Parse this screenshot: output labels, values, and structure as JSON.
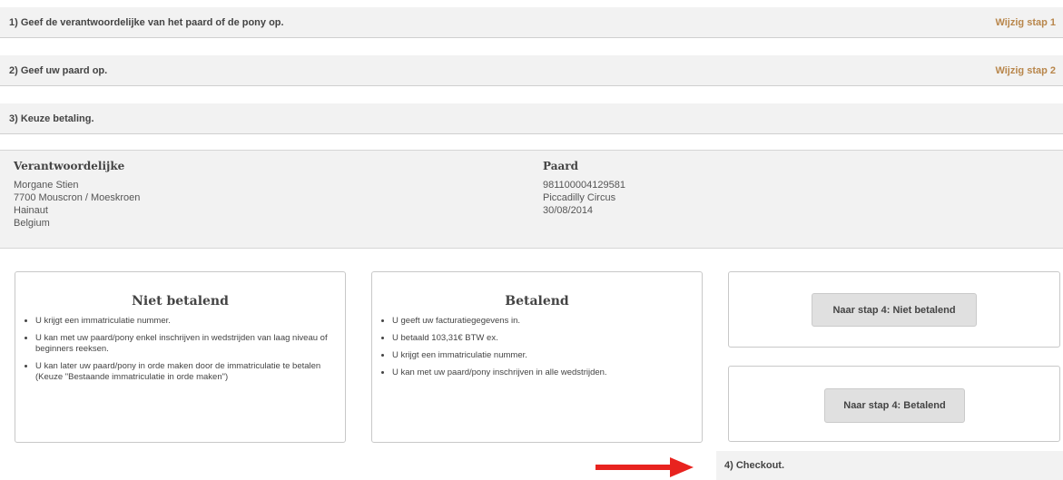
{
  "steps": {
    "step1": {
      "title": "1)  Geef de verantwoordelijke van het paard of de pony op.",
      "link": "Wijzig stap 1"
    },
    "step2": {
      "title": "2)  Geef uw paard op.",
      "link": "Wijzig stap 2"
    },
    "step3": {
      "title": "3)  Keuze betaling."
    },
    "step4": {
      "title": "4)  Checkout."
    }
  },
  "summary": {
    "responsible": {
      "heading": "Verantwoordelijke",
      "lines": [
        "Morgane Stien",
        "7700 Mouscron / Moeskroen",
        "Hainaut",
        "Belgium"
      ]
    },
    "horse": {
      "heading": "Paard",
      "lines": [
        "981100004129581",
        "Piccadilly Circus",
        "30/08/2014"
      ]
    }
  },
  "options": {
    "niet_betalend": {
      "title": "Niet betalend",
      "items": [
        "U krijgt een immatriculatie nummer.",
        "U kan met uw paard/pony enkel inschrijven in wedstrijden van laag niveau of beginners reeksen.",
        "U kan later uw paard/pony in orde maken door de immatriculatie te betalen (Keuze \"Bestaande immatriculatie in orde maken\")"
      ],
      "button": "Naar stap 4: Niet betalend"
    },
    "betalend": {
      "title": "Betalend",
      "items": [
        "U geeft uw facturatiegegevens in.",
        "U betaald 103,31€ BTW ex.",
        "U krijgt een immatriculatie nummer.",
        "U kan met uw paard/pony inschrijven in alle wedstrijden."
      ],
      "button": "Naar stap 4: Betalend"
    }
  },
  "colors": {
    "link": "#b8864b",
    "arrow": "#e8231f",
    "bar_bg": "#f2f2f2"
  },
  "icons": {
    "arrow": "arrow-right-icon",
    "bullet": "bullet-dot"
  }
}
